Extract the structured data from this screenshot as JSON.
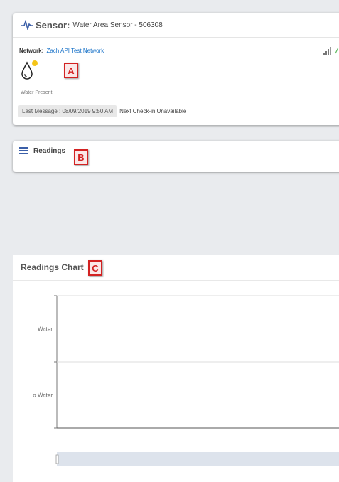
{
  "sensor": {
    "title_label": "Sensor:",
    "title_value": "Water Area Sensor - 506308",
    "network_label": "Network:",
    "network_name": "Zach API Test Network",
    "status_text": "Water Present",
    "last_message": "Last Message : 08/09/2019 9:50 AM",
    "next_checkin": "Next Check-in:Unavailable",
    "icons": [
      "pulse-icon",
      "signal-icon",
      "water-drop-icon"
    ],
    "colors": {
      "link": "#1a73c8",
      "alert_dot": "#f5c518",
      "marker": "#d32222"
    }
  },
  "readings": {
    "title": "Readings",
    "icon": "list-icon"
  },
  "chart": {
    "title": "Readings Chart"
  },
  "markers": {
    "a": "A",
    "b": "B",
    "c": "C"
  },
  "chart_data": {
    "type": "line",
    "title": "Readings Chart",
    "categories": [
      "o Water",
      "Water"
    ],
    "tick_labels": [
      "o Water",
      "Water"
    ],
    "series": [],
    "grid": true
  }
}
